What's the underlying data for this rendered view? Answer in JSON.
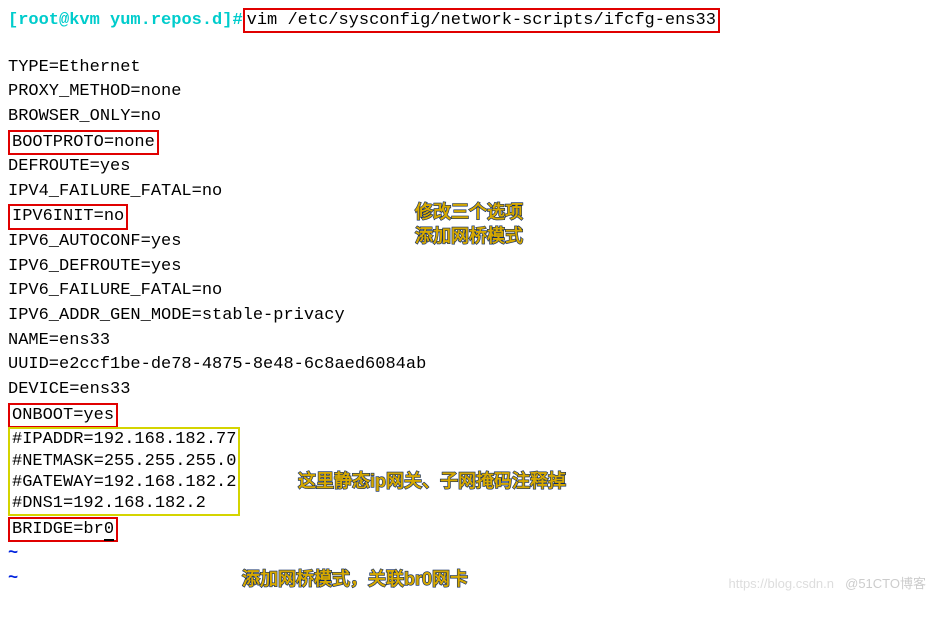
{
  "prompt": {
    "user": "[root@kvm ",
    "path": "yum.repos.d]",
    "hash": "#",
    "command": "vim /etc/sysconfig/network-scripts/ifcfg-ens33"
  },
  "cfg": {
    "l1": "TYPE=Ethernet",
    "l2": "PROXY_METHOD=none",
    "l3": "BROWSER_ONLY=no",
    "l4": "BOOTPROTO=none",
    "l5": "DEFROUTE=yes",
    "l6": "IPV4_FAILURE_FATAL=no",
    "l7": "IPV6INIT=no",
    "l8": "IPV6_AUTOCONF=yes",
    "l9": "IPV6_DEFROUTE=yes",
    "l10": "IPV6_FAILURE_FATAL=no",
    "l11": "IPV6_ADDR_GEN_MODE=stable-privacy",
    "l12": "NAME=ens33",
    "l13": "UUID=e2ccf1be-de78-4875-8e48-6c8aed6084ab",
    "l14": "DEVICE=ens33",
    "l15": "ONBOOT=yes",
    "l16": "#IPADDR=192.168.182.77",
    "l17": "#NETMASK=255.255.255.0",
    "l18": "#GATEWAY=192.168.182.2",
    "l19": "#DNS1=192.168.182.2",
    "l20a": "BRIDGE=br",
    "l20b": "0"
  },
  "anno": {
    "a1a": "修改三个选项",
    "a1b": "添加网桥模式",
    "a2": "这里静态ip网关、子网掩码注释掉",
    "a3": "添加网桥模式，关联br0网卡"
  },
  "tilde": "~",
  "wm1": "https://blog.csdn.n",
  "wm2": "@51CTO博客"
}
